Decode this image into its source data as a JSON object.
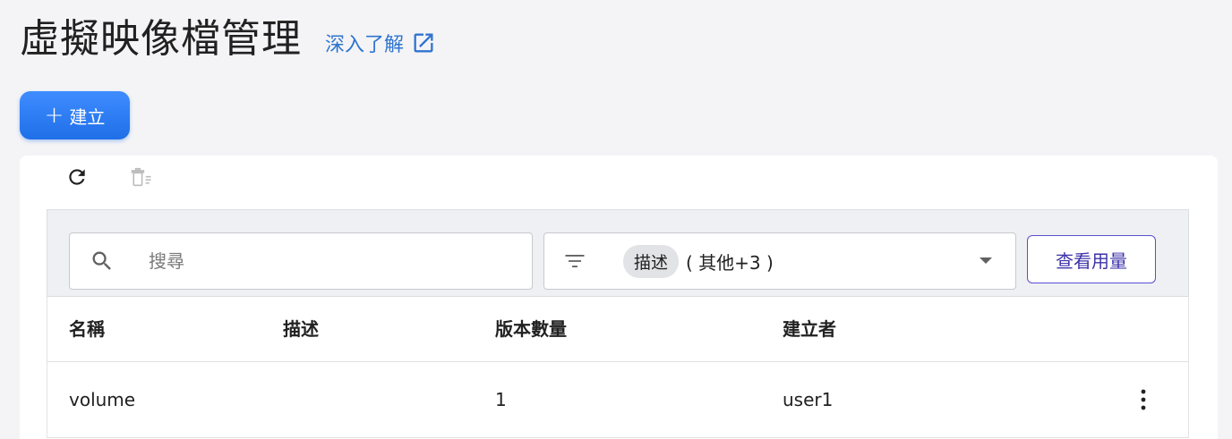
{
  "header": {
    "title": "虛擬映像檔管理",
    "learn_more": "深入了解"
  },
  "actions": {
    "create_label": "建立",
    "usage_label": "查看用量"
  },
  "filters": {
    "search_placeholder": "搜尋",
    "selected_column": "描述",
    "more_columns": "( 其他+3 )"
  },
  "table": {
    "columns": [
      "名稱",
      "描述",
      "版本數量",
      "建立者"
    ],
    "rows": [
      {
        "name": "volume",
        "description": "",
        "version_count": "1",
        "creator": "user1"
      }
    ]
  },
  "colors": {
    "accent": "#2f74d0",
    "primary_button": "#2a7ef5",
    "outline_button": "#5a4fcf"
  }
}
